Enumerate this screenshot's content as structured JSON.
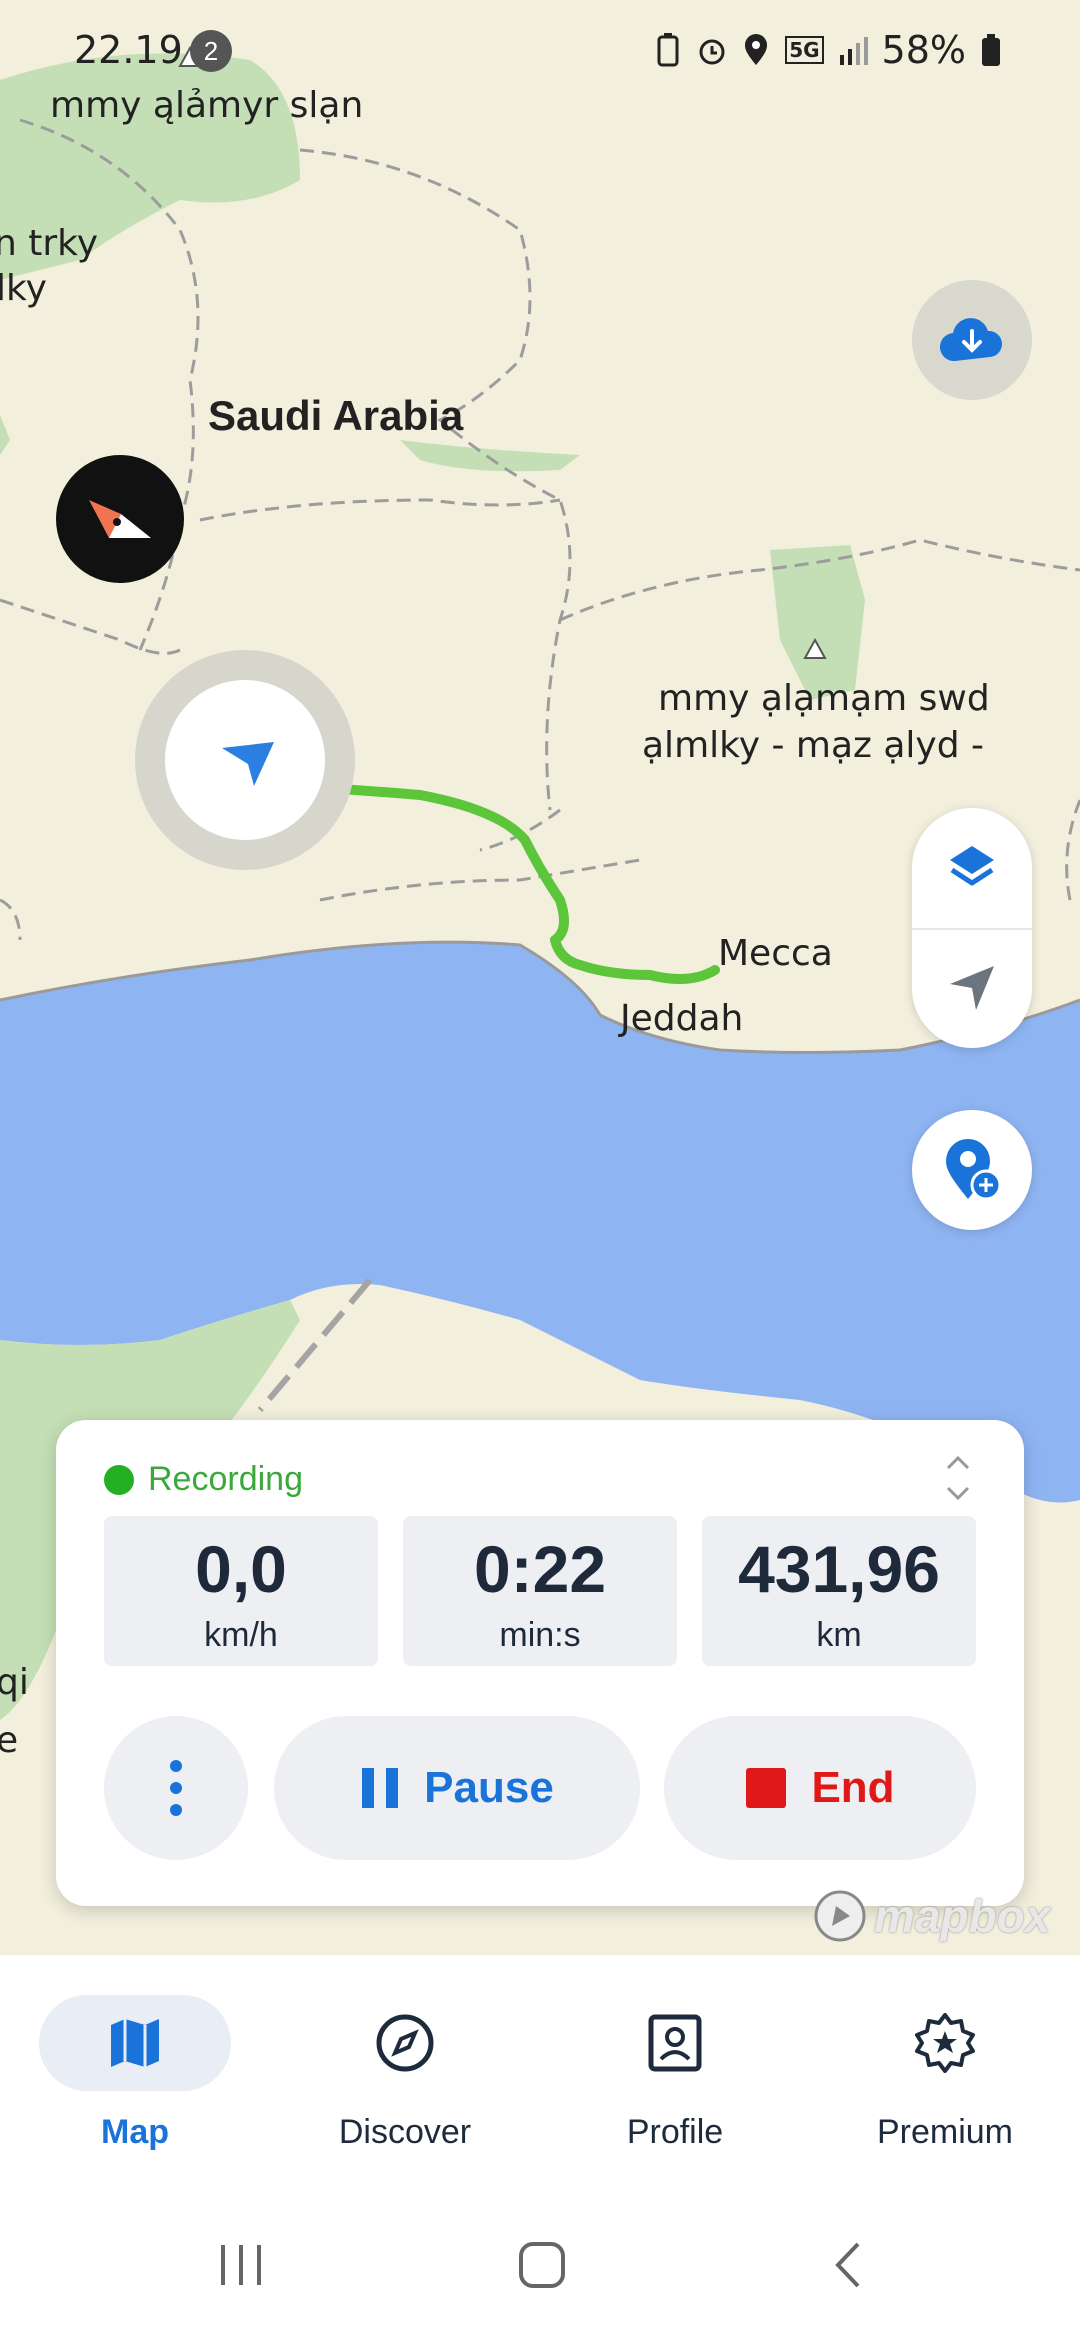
{
  "status_bar": {
    "time": "22.19",
    "notification_count": "2",
    "network": "5G",
    "battery": "58%"
  },
  "map": {
    "labels": {
      "region_north": "mmy ąlảmyr slạn",
      "region_west_1": "n trky",
      "region_west_2": "lky",
      "country": "Saudi Arabia",
      "reserve_1": "mmy ạlạmạm swd",
      "reserve_2": "ạlmlky - mạz ạlyd  -",
      "city_1": "Mecca",
      "city_2": "Jeddah",
      "edge_1": "qi",
      "edge_2": "e"
    },
    "attribution": "mapbox",
    "colors": {
      "land": "#f2efdd",
      "sea": "#8fb4f2",
      "park": "#c4dfb5",
      "route": "#5cc53a",
      "accent": "#1a73d9"
    }
  },
  "recording_card": {
    "status": "Recording",
    "stats": [
      {
        "value": "0,0",
        "unit": "km/h"
      },
      {
        "value": "0:22",
        "unit": "min:s"
      },
      {
        "value": "431,96",
        "unit": "km"
      }
    ],
    "pause_label": "Pause",
    "end_label": "End"
  },
  "bottom_nav": {
    "items": [
      {
        "label": "Map",
        "icon": "map-icon"
      },
      {
        "label": "Discover",
        "icon": "compass-icon"
      },
      {
        "label": "Profile",
        "icon": "profile-icon"
      },
      {
        "label": "Premium",
        "icon": "star-badge-icon"
      }
    ]
  }
}
